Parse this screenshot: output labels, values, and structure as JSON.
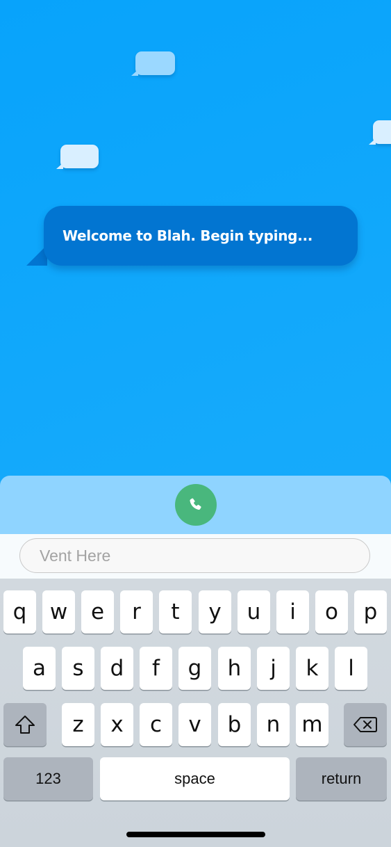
{
  "chat": {
    "welcome_message": "Welcome to Blah. Begin typing..."
  },
  "call_panel": {
    "call_button_icon": "phone-icon",
    "call_button_color": "#49b77d"
  },
  "composer": {
    "placeholder": "Vent Here",
    "value": ""
  },
  "keyboard": {
    "row1": [
      "q",
      "w",
      "e",
      "r",
      "t",
      "y",
      "u",
      "i",
      "o",
      "p"
    ],
    "row2": [
      "a",
      "s",
      "d",
      "f",
      "g",
      "h",
      "j",
      "k",
      "l"
    ],
    "row3": [
      "z",
      "x",
      "c",
      "v",
      "b",
      "n",
      "m"
    ],
    "shift_icon": "shift-icon",
    "backspace_icon": "backspace-icon",
    "numbers_label": "123",
    "space_label": "space",
    "return_label": "return"
  },
  "colors": {
    "background": "#0aa4fb",
    "welcome_bubble": "#0275d1",
    "call_panel": "#8fd4ff"
  }
}
